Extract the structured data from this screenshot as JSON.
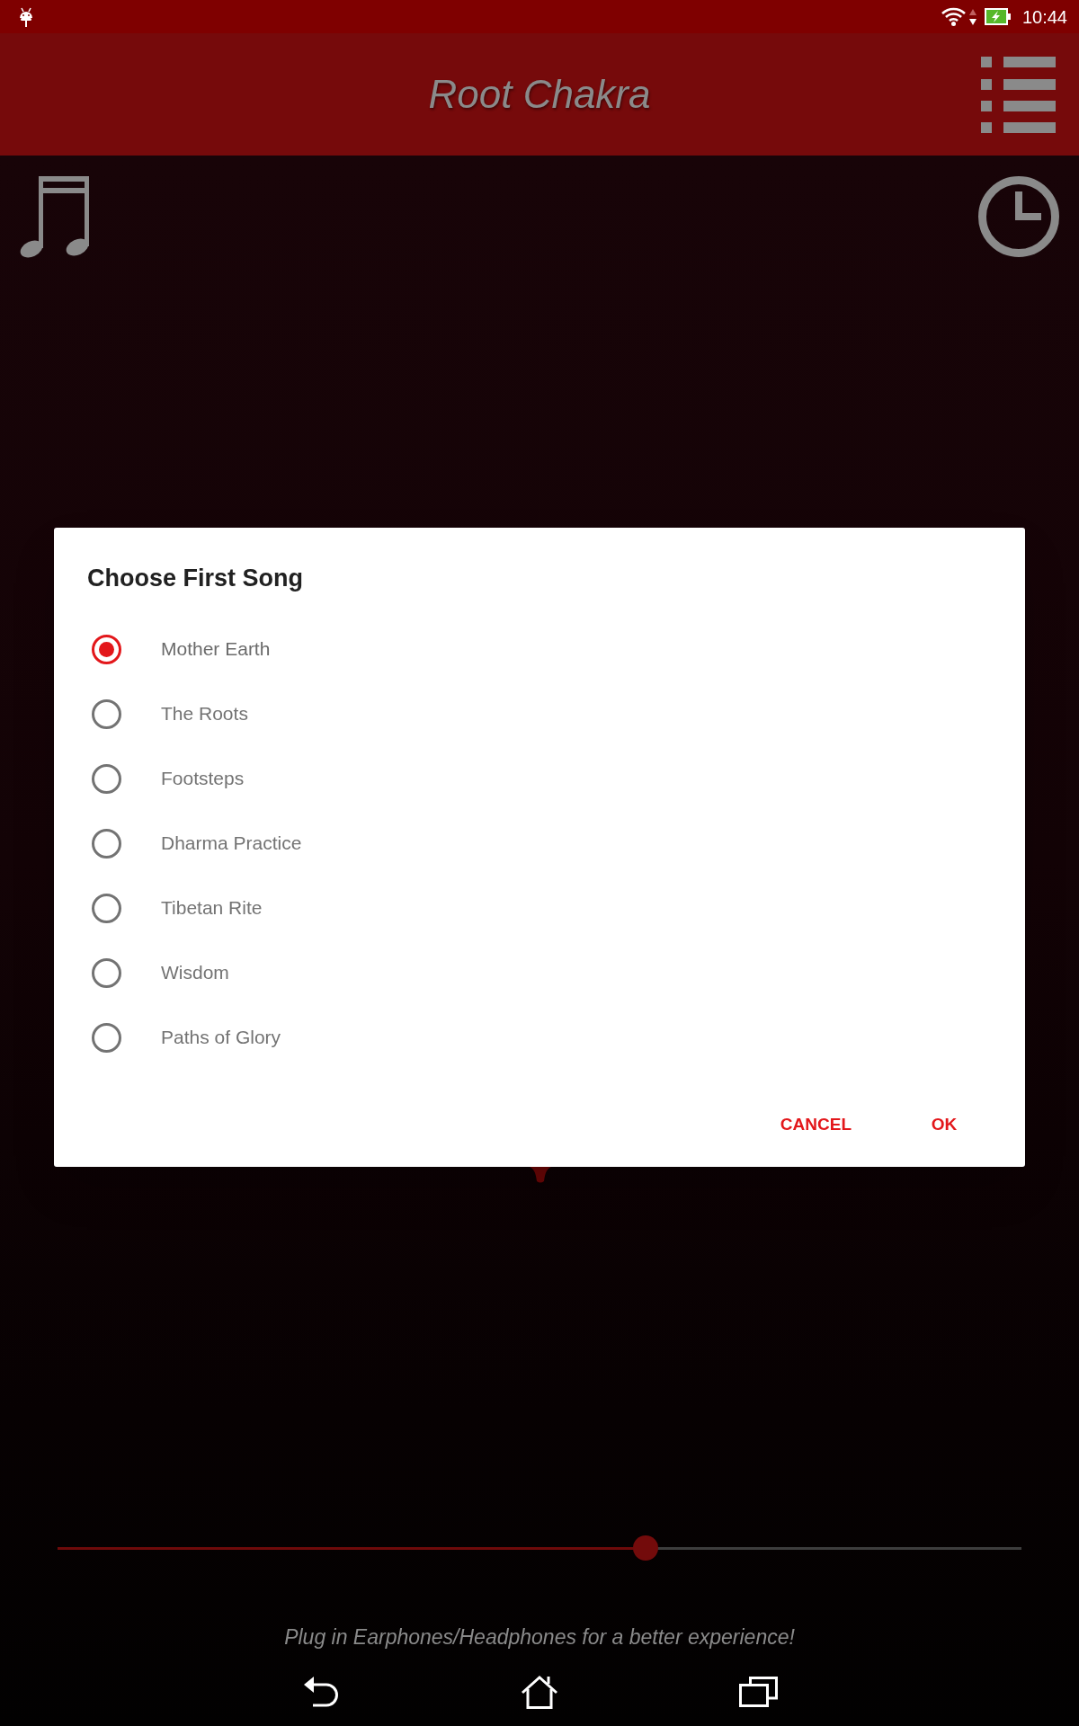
{
  "status_bar": {
    "time": "10:44"
  },
  "app_bar": {
    "title": "Root Chakra"
  },
  "dialog": {
    "title": "Choose First Song",
    "options": [
      {
        "label": "Mother Earth",
        "selected": true
      },
      {
        "label": "The Roots",
        "selected": false
      },
      {
        "label": "Footsteps",
        "selected": false
      },
      {
        "label": "Dharma Practice",
        "selected": false
      },
      {
        "label": "Tibetan Rite",
        "selected": false
      },
      {
        "label": "Wisdom",
        "selected": false
      },
      {
        "label": "Paths of Glory",
        "selected": false
      }
    ],
    "buttons": [
      {
        "label": "CANCEL"
      },
      {
        "label": "OK"
      }
    ]
  },
  "seek_slider": {
    "level": 0.61
  },
  "hint": "Plug in Earphones/Headphones for a better experience!"
}
